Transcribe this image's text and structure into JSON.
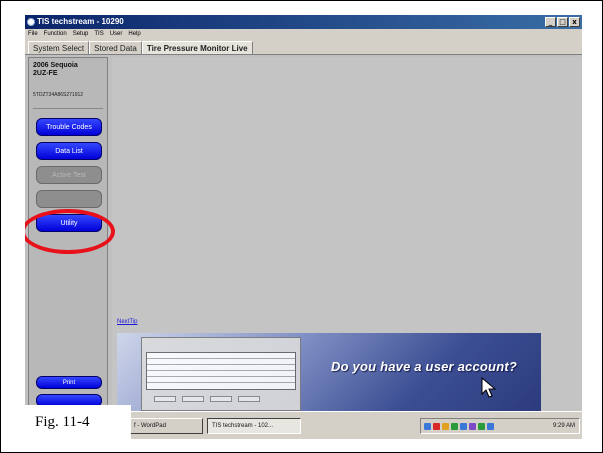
{
  "window": {
    "title": "TIS techstream - 10290",
    "minimize": "_",
    "maximize": "□",
    "close": "x"
  },
  "menu": [
    "File",
    "Function",
    "Setup",
    "TIS",
    "User",
    "Help"
  ],
  "tabs": [
    {
      "label": "System Select",
      "active": false
    },
    {
      "label": "Stored Data",
      "active": false
    },
    {
      "label": "Tire Pressure Monitor Live",
      "active": true
    }
  ],
  "sidebar": {
    "vehicle_line1": "2006 Sequoia",
    "vehicle_line2": "2UZ-FE",
    "vin": "5TDZT34A86S271912",
    "buttons": [
      {
        "label": "Trouble Codes",
        "enabled": true
      },
      {
        "label": "Data List",
        "enabled": true
      },
      {
        "label": "Active Test",
        "enabled": false
      },
      {
        "label": "",
        "enabled": false
      },
      {
        "label": "Utility",
        "enabled": true
      }
    ],
    "print_label": "Print"
  },
  "main": {
    "next_tip": "NextTip",
    "banner_text": "Do you have a user account?"
  },
  "taskbar": {
    "items": [
      {
        "label": "f - WordPad",
        "active": false
      },
      {
        "label": "TIS techstream - 102...",
        "active": true
      }
    ],
    "clock": "9:29 AM"
  },
  "caption": "Fig. 11-4",
  "colors": {
    "highlight_ring": "#e8101a",
    "button_blue": "#0000d8",
    "title_bar": "#0a246a"
  }
}
